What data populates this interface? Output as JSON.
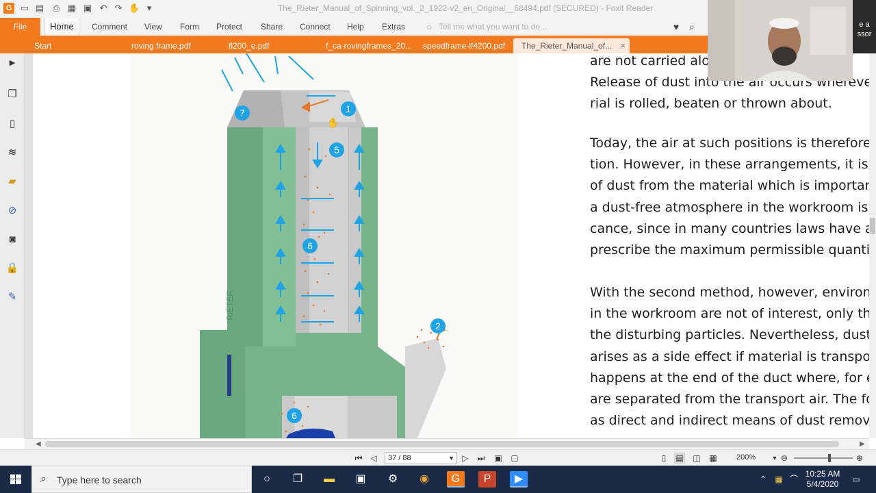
{
  "window": {
    "title": "The_Rieter_Manual_of_Spinning_vol._2_1922-v2_en_Original__68494.pdf (SECURED) - Foxit Reader",
    "app_logo": "G"
  },
  "ribbon": {
    "file_label": "File",
    "menu": [
      "Home",
      "Comment",
      "View",
      "Form",
      "Protect",
      "Share",
      "Connect",
      "Help",
      "Extras"
    ],
    "tell_me": "Tell me what you want to do..."
  },
  "tabs": [
    {
      "label": "Start"
    },
    {
      "label": "roving frame.pdf"
    },
    {
      "label": "fl200_e.pdf"
    },
    {
      "label": "f_ca-rovingframes_20..."
    },
    {
      "label": "speedframe-lf4200.pdf"
    },
    {
      "label": "The_Rieter_Manual_of..."
    }
  ],
  "active_tab_close": "×",
  "document": {
    "paragraphs": [
      [
        "are not carried alo",
        "Release of dust into the air occurs whereve",
        "rial is rolled, beaten or thrown about."
      ],
      [
        "Today, the air at such positions is therefore ext",
        "tion. However, in these arrangements, it is not",
        "of dust from the material which is important. N",
        "a dust-free atmosphere in the workroom is of s",
        "cance, since in many countries laws have alrea",
        "prescribe the maximum permissible quantities"
      ],
      [
        "With the second method, however, environn",
        "in the workroom are not of interest, only the",
        "the disturbing particles. Nevertheless, dust",
        "arises as a side effect if material is transpor",
        "happens at the end of the duct where, for ex",
        "are separated from the transport air. The fol",
        "as direct and indirect means of dust remova"
      ]
    ],
    "figure_labels": [
      "7",
      "1",
      "5",
      "6",
      "2",
      "6"
    ],
    "machine_brand": "RIETER"
  },
  "status": {
    "page_indicator": "37 / 88",
    "zoom": "200%"
  },
  "taskbar": {
    "search_placeholder": "Type here to search",
    "time": "10:25 AM",
    "date": "5/4/2020"
  },
  "webcam_overlay": {
    "text_lines": [
      "e a",
      "ssor"
    ]
  },
  "colors": {
    "accent": "#f47a1f",
    "machine_green": "#77b48a",
    "arrow_blue": "#1ea3e6",
    "dust_orange": "#e8782a"
  }
}
